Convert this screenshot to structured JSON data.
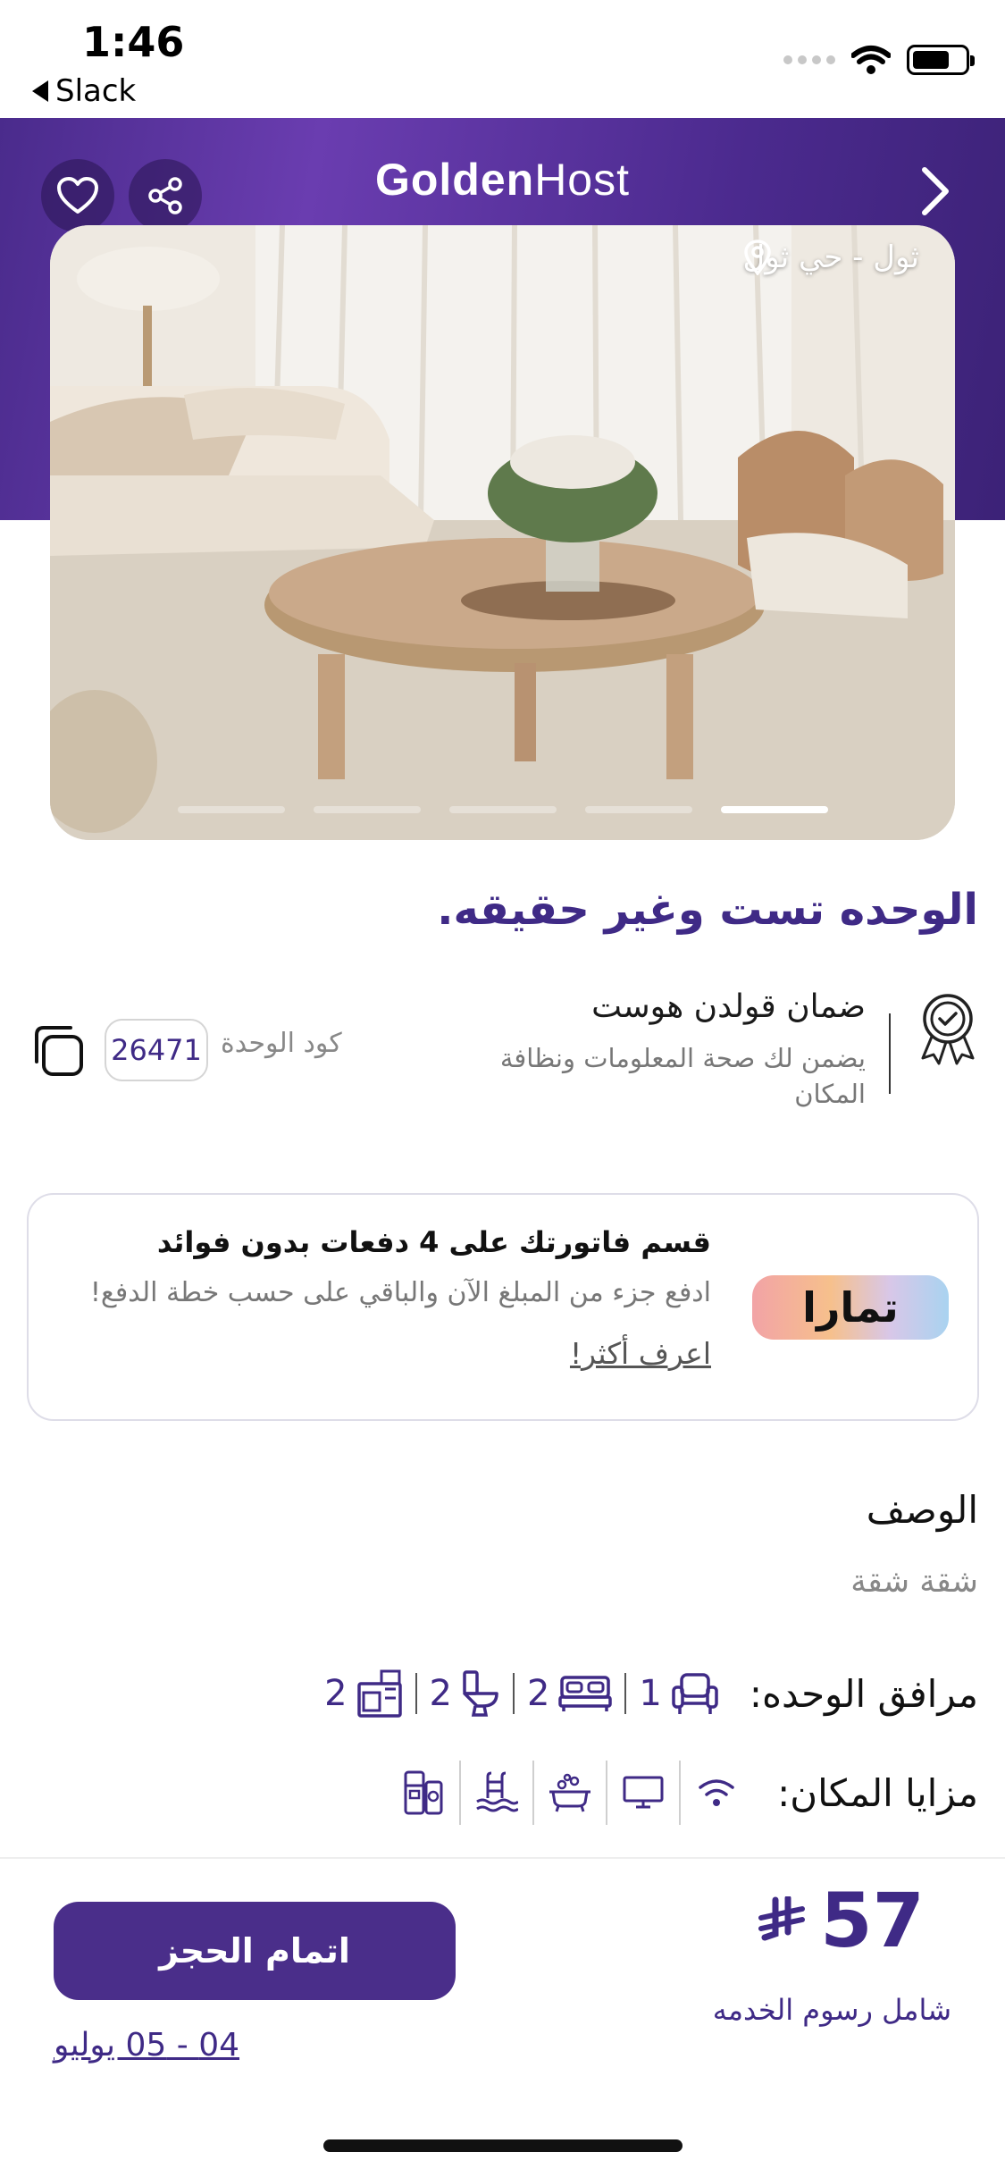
{
  "status_bar": {
    "time": "1:46",
    "back_app": "Slack"
  },
  "header": {
    "brand_bold": "Golden",
    "brand_regular": "Host",
    "icons": [
      "heart-icon",
      "share-icon",
      "chevron-right-icon"
    ]
  },
  "gallery": {
    "location": "ثول - حي ثول",
    "image_count": 5,
    "active_index": 5
  },
  "unit": {
    "title": "الوحده تست وغير حقيقه.",
    "guarantee_title": "ضمان قولدن هوست",
    "guarantee_subtitle": "يضمن لك صحة المعلومات ونظافة المكان",
    "code_label": "كود الوحدة",
    "code_value": "26471"
  },
  "tamara": {
    "logo_text": "تمارا",
    "title": "قسم فاتورتك على 4 دفعات بدون فوائد",
    "subtitle": "ادفع جزء من المبلغ الآن والباقي على حسب خطة الدفع!",
    "link": "اعرف أكثر!"
  },
  "description": {
    "heading": "الوصف",
    "value": "شقة شقة"
  },
  "facilities": {
    "label": "مرافق الوحده:",
    "items": [
      {
        "icon": "armchair-icon",
        "count": "1"
      },
      {
        "icon": "bed-icon",
        "count": "2"
      },
      {
        "icon": "toilet-icon",
        "count": "2"
      },
      {
        "icon": "kitchen-icon",
        "count": "2"
      }
    ]
  },
  "amenities": {
    "label": "مزايا المكان:",
    "items": [
      "wifi-icon",
      "tv-icon",
      "bathtub-icon",
      "pool-icon",
      "appliances-icon"
    ]
  },
  "booking": {
    "price": "57",
    "currency_icon": "riyal-icon",
    "price_note": "شامل رسوم الخدمه",
    "button": "اتمام الحجز",
    "dates": "04 - 05 يوليو"
  },
  "colors": {
    "brand_purple": "#4a2e8a",
    "text_purple": "#3f2a86"
  }
}
